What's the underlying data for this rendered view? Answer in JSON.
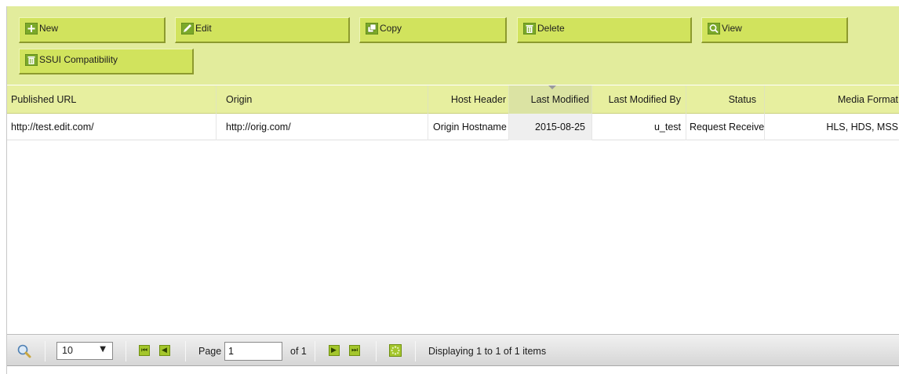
{
  "toolbar": {
    "buttons": [
      {
        "label": "New",
        "icon": "plus-icon"
      },
      {
        "label": "Edit",
        "icon": "pencil-icon"
      },
      {
        "label": "Copy",
        "icon": "copy-icon"
      },
      {
        "label": "Delete",
        "icon": "trash-icon"
      },
      {
        "label": "View",
        "icon": "magnifier-icon"
      },
      {
        "label": "SSUI Compatibility",
        "icon": "trash-icon"
      }
    ]
  },
  "grid": {
    "columns": [
      "Published URL",
      "Origin",
      "Host Header",
      "Last Modified",
      "Last Modified By",
      "Status",
      "Media Format"
    ],
    "sorted_column": "Last Modified",
    "rows": [
      [
        "http://test.edit.com/",
        "http://orig.com/",
        "Origin Hostname",
        "2015-08-25",
        "u_test",
        "Request Received",
        "HLS, HDS, MSS"
      ]
    ]
  },
  "pager": {
    "page_size": "10",
    "page_label": "Page",
    "page_value": "1",
    "of_label": "of 1",
    "status": "Displaying 1 to 1 of 1 items"
  },
  "colors": {
    "toolbar_bg": "#e2ec9c",
    "button_bg": "#d1e35d",
    "header_bg": "#e7ef9f",
    "icon_green": "#a4c62c"
  }
}
